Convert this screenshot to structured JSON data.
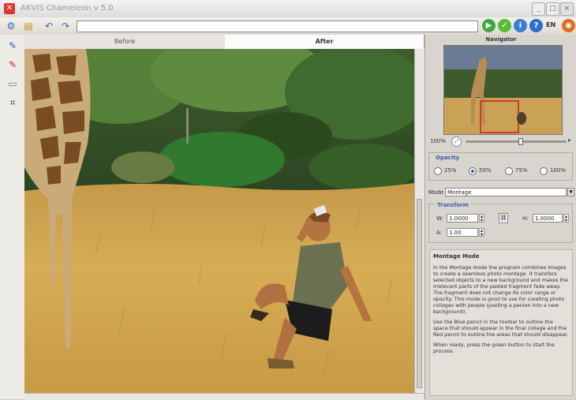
{
  "window": {
    "title": "AKVIS Chameleon v 5.0",
    "app_icon": "app-logo-icon",
    "controls": [
      "minimize",
      "maximize",
      "close"
    ]
  },
  "toolbar": {
    "icons": [
      "settings-icon",
      "open-icon",
      "undo-icon",
      "redo-icon"
    ],
    "url_value": "",
    "round_buttons": [
      "run-icon",
      "apply-icon",
      "info-icon",
      "help-icon"
    ],
    "language": "EN",
    "accent": "#3fa63f"
  },
  "tools": [
    "blue-pencil-icon",
    "red-pencil-icon",
    "eraser-icon",
    "crop-icon"
  ],
  "tabs": {
    "before": "Before",
    "after": "After"
  },
  "navigator": {
    "title": "Navigator",
    "zoom_value": "100%",
    "zoom_fraction": 0.55
  },
  "opacity": {
    "label": "Opacity",
    "options": [
      "25%",
      "50%",
      "75%",
      "100%"
    ],
    "selected": "50%"
  },
  "mode": {
    "label": "Mode",
    "value": "Montage"
  },
  "transform": {
    "label": "Transform",
    "w_label": "W:",
    "w_value": "1.0000",
    "h_label": "H:",
    "h_value": "1.0000",
    "a_label": "A:",
    "a_value": "1.00"
  },
  "help": {
    "title": "Montage Mode",
    "p1": "In the Montage mode the program combines images to create a seamless photo montage. It transfers selected objects to a new background and makes the irrelevant parts of the pasted fragment fade away. The fragment does not change its color range or opacity. This mode is good to use for creating photo collages with people (pasting a person into a new background).",
    "p2": "Use the Blue pencil in the toolbar to outline the space that should appear in the final collage and the Red pencil to outline the areas that should disappear.",
    "p3": "When ready, press the green button to start the process."
  }
}
